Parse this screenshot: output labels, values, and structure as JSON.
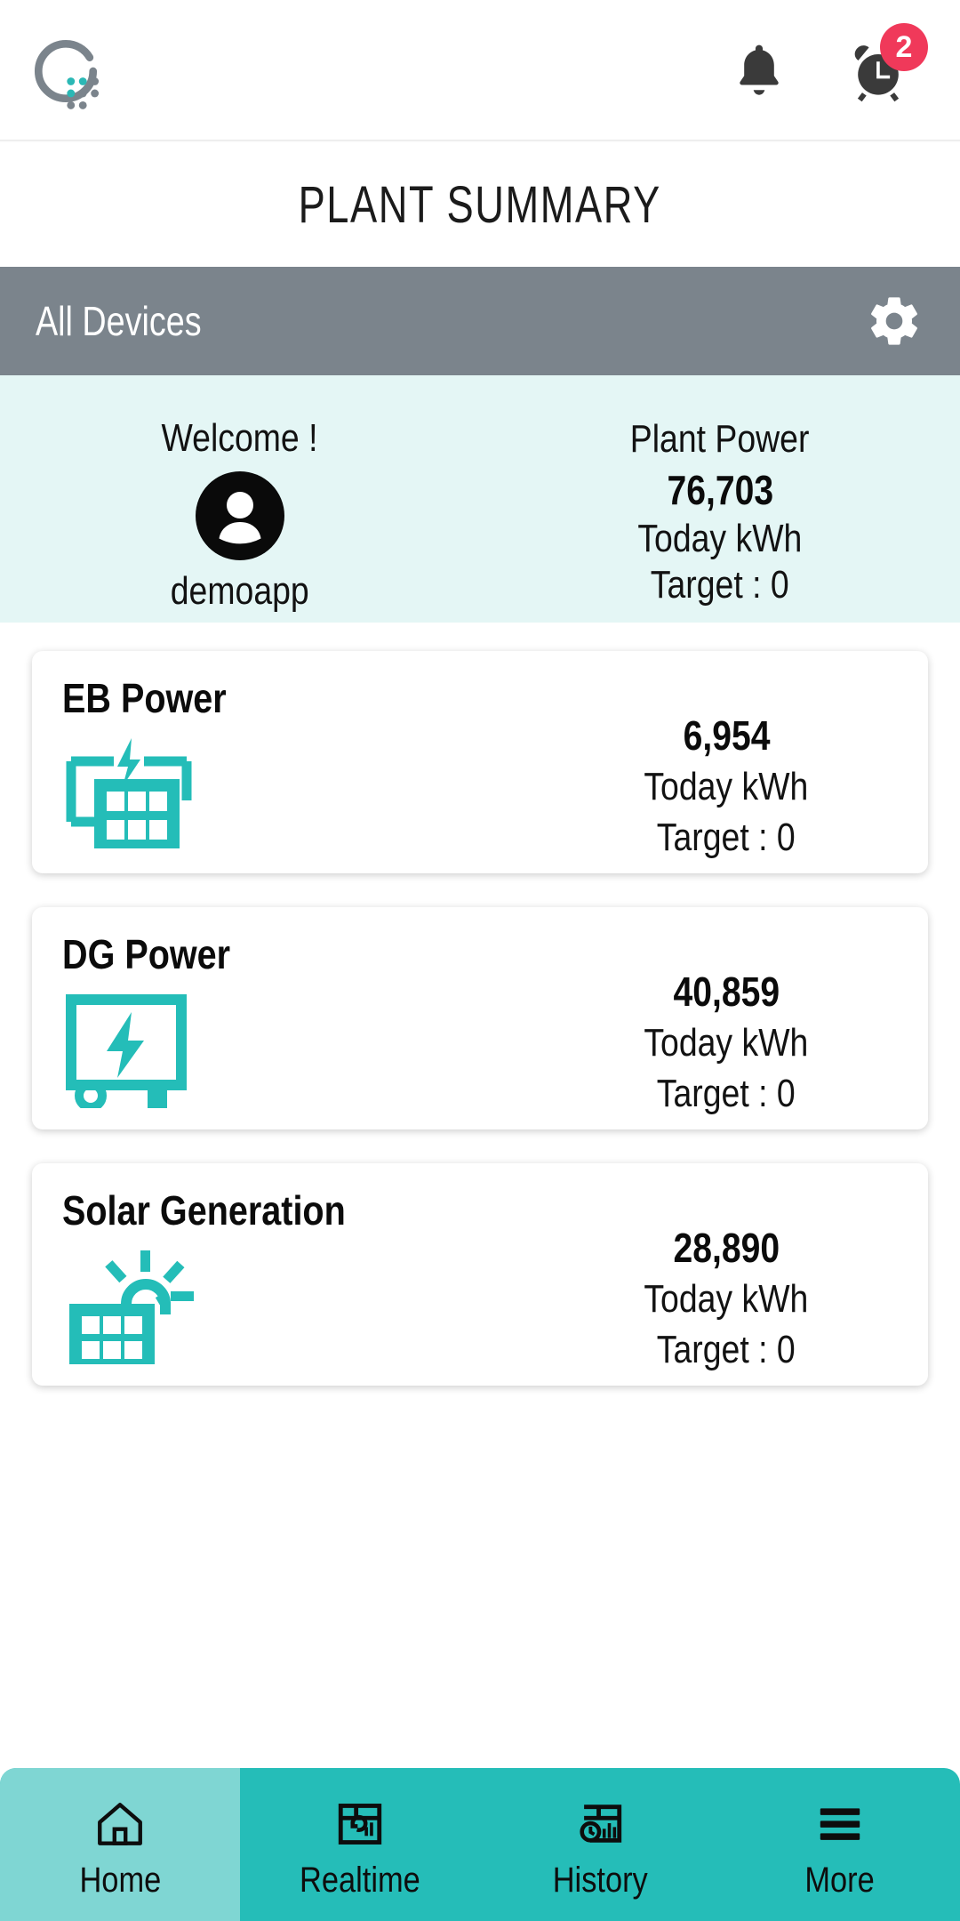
{
  "topbar": {
    "logo_name": "quantum-dots-logo",
    "notifications_icon": "bell-icon",
    "alarms_icon": "alarm-clock-icon",
    "alarm_badge_count": "2",
    "badge_color": "#f0395a"
  },
  "header": {
    "title": "PLANT SUMMARY"
  },
  "device_bar": {
    "label": "All Devices",
    "settings_icon": "gear-icon",
    "background_color": "#7b848c"
  },
  "summary": {
    "welcome_text": "Welcome !",
    "avatar_icon": "user-avatar-icon",
    "username": "demoapp",
    "plant": {
      "label": "Plant Power",
      "value": "76,703",
      "unit": "Today kWh",
      "target": "Target : 0"
    },
    "background_color": "#e4f6f5"
  },
  "cards": [
    {
      "title": "EB Power",
      "icon": "grid-power-building-icon",
      "value": "6,954",
      "unit": "Today kWh",
      "target": "Target : 0"
    },
    {
      "title": "DG Power",
      "icon": "diesel-generator-icon",
      "value": "40,859",
      "unit": "Today kWh",
      "target": "Target : 0"
    },
    {
      "title": "Solar Generation",
      "icon": "solar-panel-sun-icon",
      "value": "28,890",
      "unit": "Today kWh",
      "target": "Target : 0"
    }
  ],
  "bottom_nav": {
    "accent_color": "#25bdb8",
    "active_color": "#7fd6d3",
    "items": [
      {
        "label": "Home",
        "icon": "home-icon",
        "active": true
      },
      {
        "label": "Realtime",
        "icon": "realtime-dashboard-icon",
        "active": false
      },
      {
        "label": "History",
        "icon": "history-clock-chart-icon",
        "active": false
      },
      {
        "label": "More",
        "icon": "hamburger-menu-icon",
        "active": false
      }
    ]
  },
  "theme": {
    "teal": "#25bdb8",
    "icon_teal": "#24bdb8"
  }
}
